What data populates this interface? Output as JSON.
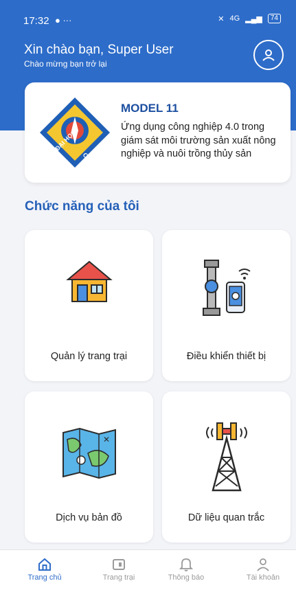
{
  "status_bar": {
    "time": "17:32",
    "extra": "● ···",
    "network": "4G",
    "battery": "74"
  },
  "header": {
    "greeting": "Xin chào bạn, Super User",
    "subtitle": "Chào mừng bạn trở lại"
  },
  "banner": {
    "title": "MODEL 11",
    "description": "Ứng dụng công nghiệp 4.0 trong giám sát môi trường sản xuất nông nghiệp và nuôi trồng thủy sản",
    "logo_text_left": "ĐẠI HỌC",
    "logo_text_right": "CẦN THƠ"
  },
  "section": {
    "title": "Chức năng của tôi"
  },
  "features": [
    {
      "label": "Quản lý trang trại",
      "icon": "house-icon"
    },
    {
      "label": "Điều khiển thiết bị",
      "icon": "remote-valve-icon"
    },
    {
      "label": "Dịch vụ bản đồ",
      "icon": "map-icon"
    },
    {
      "label": "Dữ liệu quan trắc",
      "icon": "signal-tower-icon"
    }
  ],
  "tabs": [
    {
      "label": "Trang chủ",
      "icon": "home-icon",
      "active": true
    },
    {
      "label": "Trang trại",
      "icon": "farm-icon",
      "active": false
    },
    {
      "label": "Thông báo",
      "icon": "bell-icon",
      "active": false
    },
    {
      "label": "Tài khoản",
      "icon": "user-icon",
      "active": false
    }
  ],
  "colors": {
    "primary": "#2d6cc9",
    "title": "#1c4fa0",
    "background": "#f3f4f8"
  }
}
